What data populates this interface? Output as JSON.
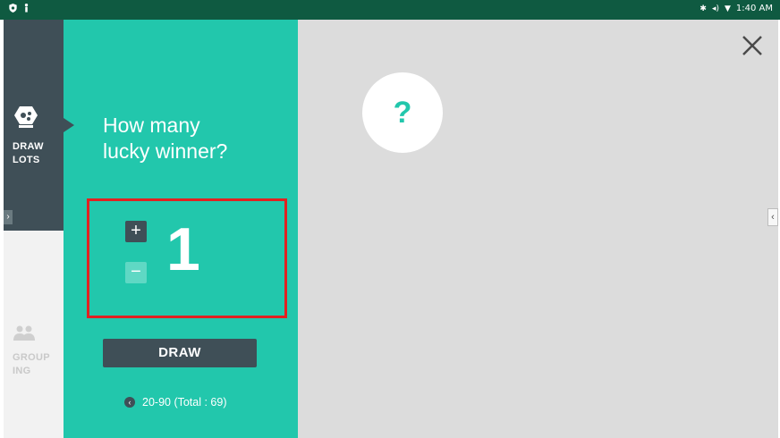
{
  "status_bar": {
    "time": "1:40 AM",
    "left_icons": [
      "shield-icon",
      "person-icon"
    ],
    "right_icons": [
      "bluetooth-icon",
      "volume-icon",
      "wifi-icon"
    ]
  },
  "sidebar": {
    "draw_lots": {
      "label_line1": "DRAW",
      "label_line2": "LOTS",
      "icon": "dice-icon"
    },
    "grouping": {
      "label_line1": "GROUP",
      "label_line2": "ING",
      "icon": "people-icon"
    },
    "expand_glyph": "›"
  },
  "panel": {
    "question_line1": "How many",
    "question_line2": "lucky winner?",
    "counter": {
      "plus": "+",
      "minus": "−",
      "value": "1"
    },
    "draw_button": "DRAW",
    "range_text": "20-90 (Total : 69)",
    "back_glyph": "‹"
  },
  "result": {
    "placeholder": "?"
  },
  "controls": {
    "side_tab_glyph": "‹"
  },
  "colors": {
    "status_bar": "#0f5a41",
    "panel": "#22c7ac",
    "rail_active": "#3f4f57",
    "highlight_border": "#e12121",
    "background": "#dcdcdc"
  }
}
